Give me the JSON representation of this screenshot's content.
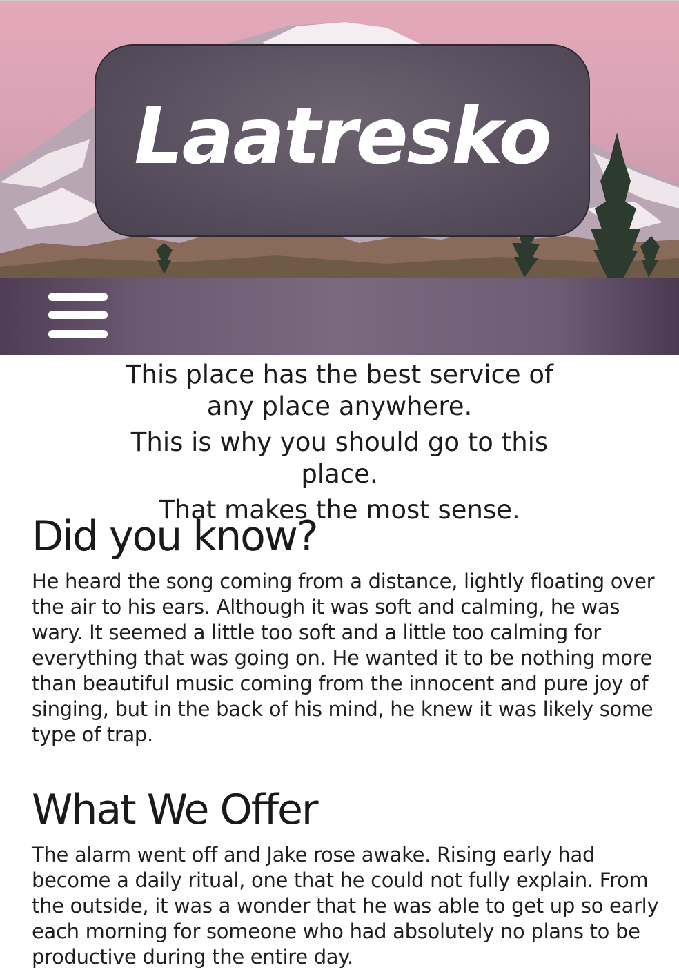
{
  "site": {
    "title": "Laatresko"
  },
  "nav": {
    "menu_icon": "hamburger-menu-icon"
  },
  "intro": {
    "lines": [
      "This place has the best service of any place anywhere.",
      "This is why you should go to this place.",
      "That makes the most sense."
    ]
  },
  "sections": [
    {
      "heading": "Did you know?",
      "body": "He heard the song coming from a distance, lightly floating over the air to his ears. Although it was soft and calming, he was wary. It seemed a little too soft and a little too calming for everything that was going on. He wanted it to be nothing more than beautiful music coming from the innocent and pure joy of singing, but in the back of his mind, he knew it was likely some type of trap."
    },
    {
      "heading": "What We Offer",
      "body": "The alarm went off and Jake rose awake. Rising early had become a daily ritual, one that he could not fully explain. From the outside, it was a wonder that he was able to get up so early each morning for someone who had absolutely no plans to be productive during the entire day."
    }
  ],
  "colors": {
    "sky": "#e2a9b9",
    "title_box": "#5a5060",
    "navbar": "#7a6a80",
    "text": "#1f1f1f"
  }
}
